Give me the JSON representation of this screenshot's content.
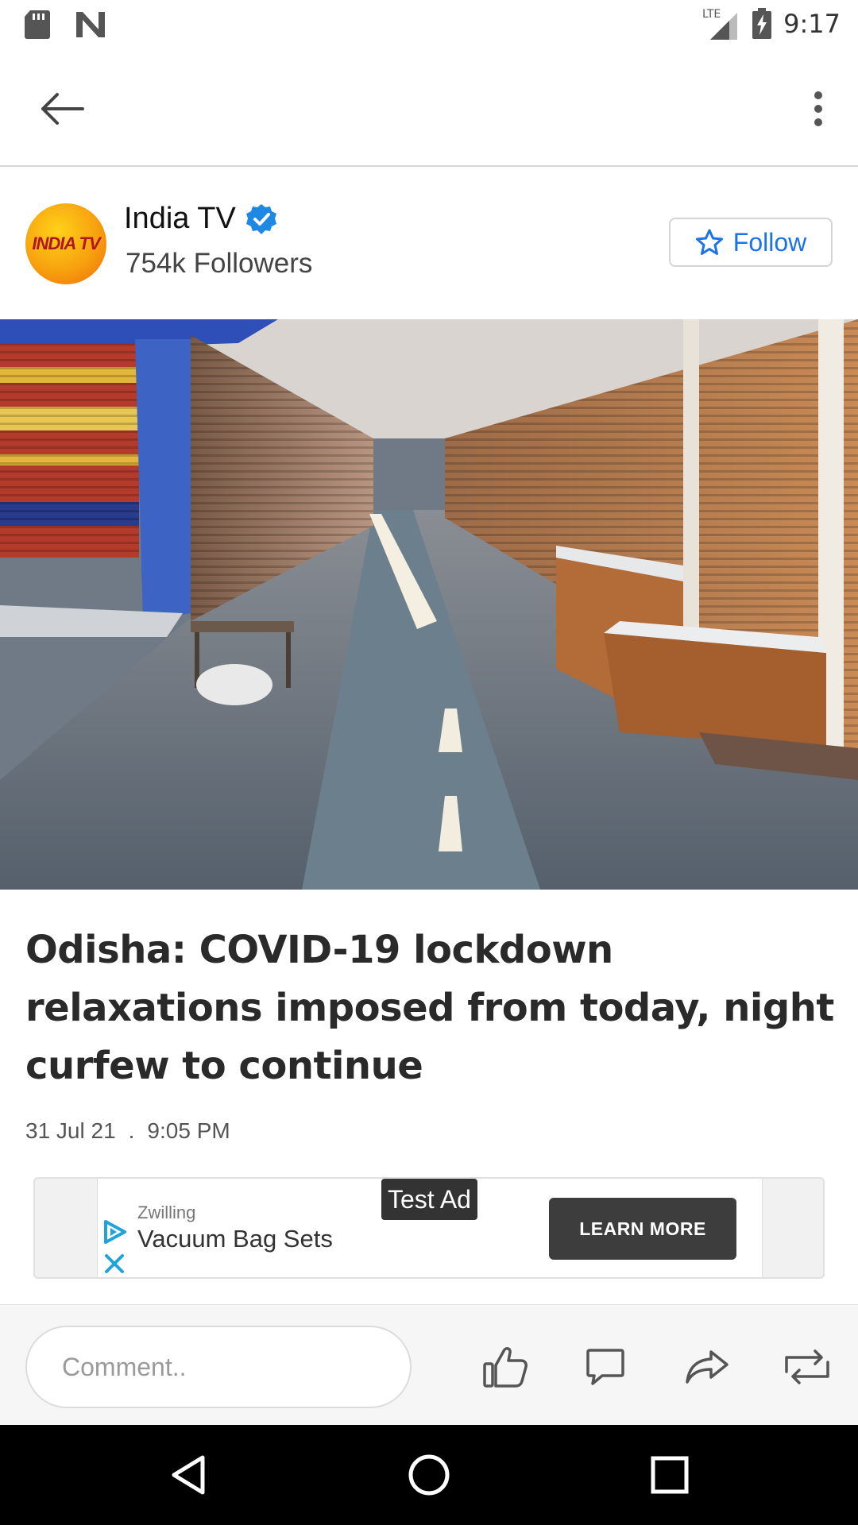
{
  "status_bar": {
    "time": "9:17",
    "network": "LTE"
  },
  "publisher": {
    "name": "India TV",
    "logo_text": "INDIA TV",
    "followers": "754k Followers",
    "follow_label": "Follow"
  },
  "article": {
    "headline": "Odisha: COVID-19 lockdown relaxations imposed from today, night curfew to continue",
    "date": "31 Jul 21",
    "separator": ".",
    "time": "9:05 PM"
  },
  "ad": {
    "badge": "Test Ad",
    "brand": "Zwilling",
    "title": "Vacuum Bag Sets",
    "cta": "LEARN MORE"
  },
  "action_bar": {
    "comment_placeholder": "Comment.."
  },
  "colors": {
    "accent": "#1a73e8",
    "verified": "#1e88e5",
    "logo_orange": "#f7a10e"
  },
  "icons": [
    "sd-card-icon",
    "n-notification-icon",
    "lte-signal-icon",
    "battery-charging-icon",
    "back-arrow-icon",
    "more-vert-icon",
    "verified-badge-icon",
    "star-outline-icon",
    "ad-choices-icon",
    "ad-close-icon",
    "like-icon",
    "comment-icon",
    "share-icon",
    "repost-icon",
    "nav-back-icon",
    "nav-home-icon",
    "nav-recents-icon"
  ]
}
